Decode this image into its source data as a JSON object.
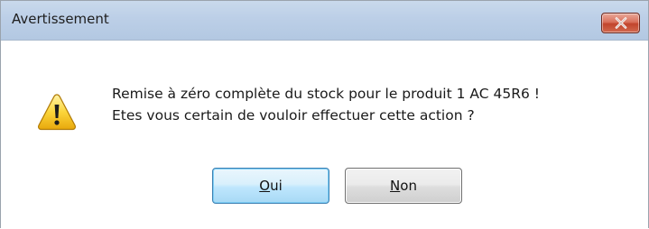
{
  "dialog": {
    "title": "Avertissement",
    "close_icon": "close-icon",
    "icon": "warning-icon",
    "message_line1": "Remise à zéro complète du stock pour le produit 1 AC 45R6 !",
    "message_line2": "Etes vous certain de vouloir effectuer cette action ?",
    "buttons": {
      "yes": {
        "mnemonic": "O",
        "rest": "ui"
      },
      "no": {
        "mnemonic": "N",
        "rest": "on"
      }
    }
  },
  "colors": {
    "titlebar": "#bccfe7",
    "close_button": "#c1452c",
    "default_button_border": "#3c7fb1"
  }
}
